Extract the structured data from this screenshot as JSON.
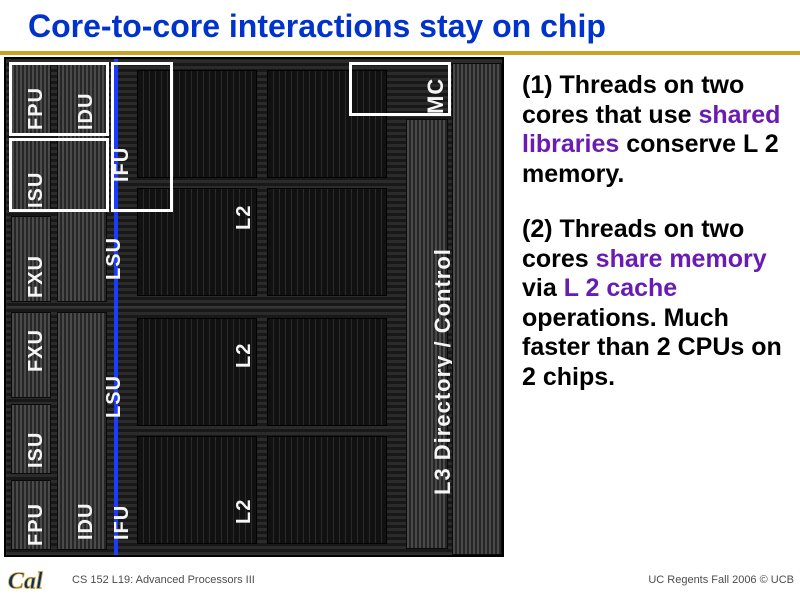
{
  "title": "Core-to-core interactions stay on chip",
  "die_labels": {
    "fpu": "FPU",
    "idu": "IDU",
    "ifu": "IFU",
    "isu": "ISU",
    "lsu": "LSU",
    "fxu": "FXU",
    "l2": "L2",
    "mc": "MC",
    "l3dir": "L3 Directory / Control"
  },
  "points": {
    "p1_num": "(1)",
    "p1_a": "Threads on two cores that use ",
    "p1_b": "shared libraries",
    "p1_c": " conserve L 2 memory.",
    "p2_num": "(2)",
    "p2_a": "Threads on two cores ",
    "p2_b": "share memory",
    "p2_c": " via ",
    "p2_d": "L 2 cache",
    "p2_e": " operations. Much faster than 2 CPUs on 2 chips."
  },
  "footer": {
    "left_logo": "Cal",
    "center": "CS 152 L19: Advanced Processors III",
    "right": "UC Regents Fall 2006 © UCB"
  }
}
